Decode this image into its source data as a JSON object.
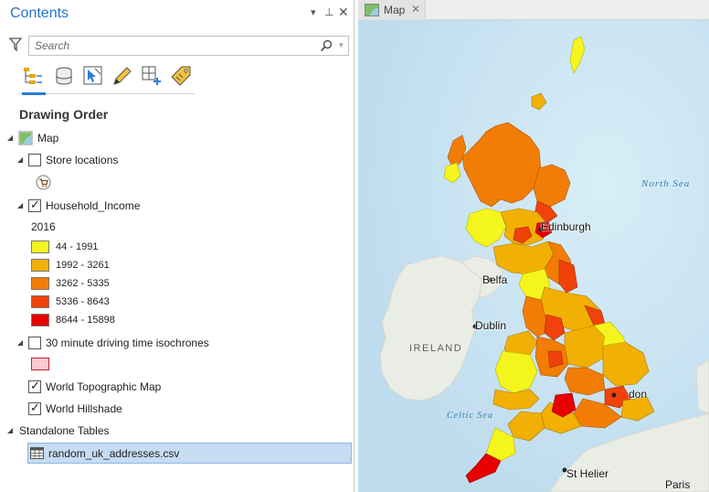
{
  "contents": {
    "title": "Contents",
    "search_placeholder": "Search",
    "toolbar_icons": [
      "list-by-drawing-order-icon",
      "list-by-data-source-icon",
      "list-by-selection-icon",
      "list-by-editing-icon",
      "list-by-snapping-icon",
      "list-by-labeling-icon"
    ],
    "drawing_order": "Drawing Order",
    "tree": {
      "map_label": "Map",
      "store_locations": "Store locations",
      "household_income": "Household_Income",
      "year_label": "2016",
      "classes": [
        {
          "label": "44 - 1991",
          "color": "#f5f51e"
        },
        {
          "label": "1992 - 3261",
          "color": "#f2b005"
        },
        {
          "label": "3262 - 5335",
          "color": "#f27d05"
        },
        {
          "label": "5336 - 8643",
          "color": "#f0420a"
        },
        {
          "label": "8644 - 15898",
          "color": "#e60000"
        }
      ],
      "isochrones": "30 minute driving time isochrones",
      "world_topo": "World Topographic Map",
      "world_hillshade": "World Hillshade",
      "standalone_tables": "Standalone Tables",
      "table_name": "random_uk_addresses.csv"
    }
  },
  "map": {
    "tab_label": "Map",
    "labels": {
      "edinburgh": "Edinburgh",
      "belfast": "Belfa",
      "dublin": "Dublin",
      "ireland": "IRELAND",
      "london": "don",
      "st_helier": "St Helier",
      "paris": "Paris",
      "north_sea": "North Sea",
      "celtic_sea": "Celtic Sea"
    }
  }
}
